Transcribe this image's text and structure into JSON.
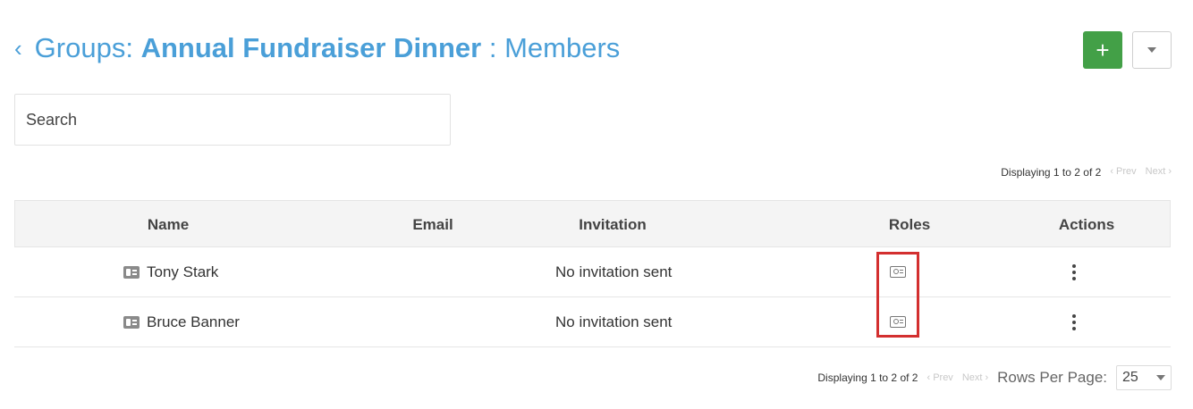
{
  "header": {
    "back_icon": "chevron-left-icon",
    "title_prefix": "Groups:",
    "group_name": "Annual Fundraiser Dinner",
    "title_suffix": ": Members",
    "accent_color": "#4a9fd8"
  },
  "toolbar": {
    "add_label": "+",
    "add_color": "#43a047",
    "dropdown_icon": "caret-down-icon"
  },
  "search": {
    "placeholder": "Search",
    "value": ""
  },
  "pagination_top": {
    "display_text": "Displaying 1 to 2 of 2",
    "prev_label": "‹ Prev",
    "next_label": "Next ›"
  },
  "table": {
    "columns": [
      "Name",
      "Email",
      "Invitation",
      "Roles",
      "Actions"
    ],
    "rows": [
      {
        "name": "Tony Stark",
        "email": "",
        "invitation": "No invitation sent",
        "roles_icon": "role-card-icon",
        "actions_icon": "kebab-menu-icon"
      },
      {
        "name": "Bruce Banner",
        "email": "",
        "invitation": "No invitation sent",
        "roles_icon": "role-card-icon",
        "actions_icon": "kebab-menu-icon"
      }
    ]
  },
  "pagination_bottom": {
    "display_text": "Displaying 1 to 2 of 2",
    "prev_label": "‹ Prev",
    "next_label": "Next ›",
    "rows_per_page_label": "Rows Per Page:",
    "rows_per_page_value": "25"
  },
  "highlight_color": "#d32f2f"
}
